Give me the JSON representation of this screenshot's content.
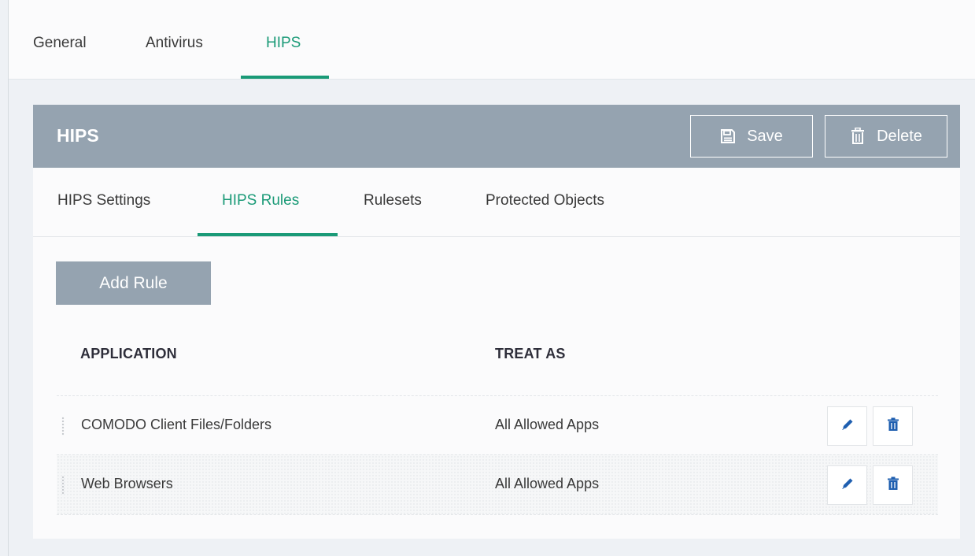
{
  "top_tabs": {
    "general": "General",
    "antivirus": "Antivirus",
    "hips": "HIPS"
  },
  "panel": {
    "title": "HIPS",
    "save_label": "Save",
    "delete_label": "Delete"
  },
  "sub_tabs": {
    "settings": "HIPS Settings",
    "rules": "HIPS Rules",
    "rulesets": "Rulesets",
    "protected": "Protected Objects"
  },
  "add_rule_label": "Add Rule",
  "table": {
    "columns": {
      "application": "APPLICATION",
      "treat_as": "TREAT AS"
    },
    "rows": [
      {
        "application": "COMODO Client Files/Folders",
        "treat_as": "All Allowed Apps"
      },
      {
        "application": "Web Browsers",
        "treat_as": "All Allowed Apps"
      }
    ]
  },
  "colors": {
    "accent": "#1a9a77",
    "header": "#95a3b0",
    "icon_blue": "#1f5fb0"
  },
  "icons": {
    "save": "floppy-disk-icon",
    "delete": "trash-icon",
    "edit": "pencil-icon",
    "drag": "drag-handle-icon"
  }
}
